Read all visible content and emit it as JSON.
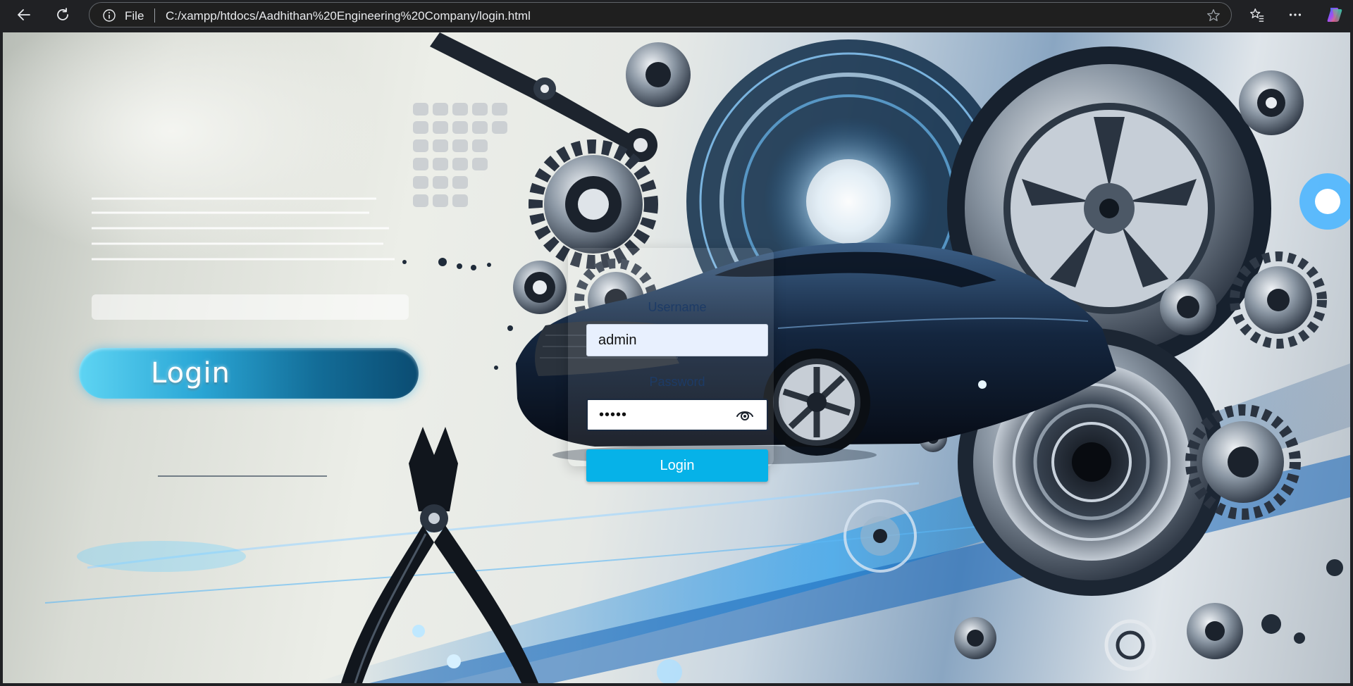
{
  "browser": {
    "back_icon": "arrow-left-icon",
    "reload_icon": "reload-icon",
    "info_icon": "info-icon",
    "scheme_label": "File",
    "url": "C:/xampp/htdocs/Aadhithan%20Engineering%20Company/login.html",
    "favorite_icon": "star-icon",
    "favorites_icon": "favorites-list-icon",
    "menu_icon": "more-icon",
    "copilot_icon": "copilot-icon"
  },
  "page": {
    "banner_text": "Login",
    "form": {
      "username_label": "Username",
      "username_value": "admin",
      "password_label": "Password",
      "password_value": "•••••",
      "show_password_icon": "eye-icon",
      "submit_label": "Login"
    }
  },
  "colors": {
    "accent": "#06b2e8",
    "label": "#1d3b66",
    "chrome_bg": "#202124"
  }
}
